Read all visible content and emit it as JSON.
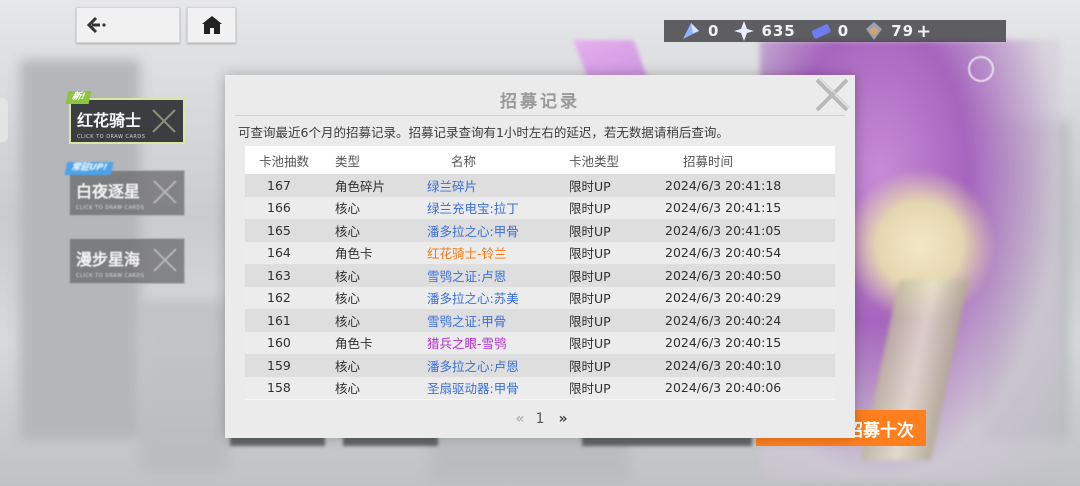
{
  "header": {
    "back_button_icon": "back-arrow-icon",
    "home_button_icon": "home-icon"
  },
  "currencies": [
    {
      "icon": "crystal-shard-icon",
      "value": "0"
    },
    {
      "icon": "star-crystal-icon",
      "value": "635"
    },
    {
      "icon": "ticket-icon",
      "value": "0"
    },
    {
      "icon": "premium-gem-icon",
      "value": "79"
    }
  ],
  "currency_plus": "+",
  "banners": [
    {
      "tag": "新!",
      "title": "红花骑士",
      "sub": "CLICK TO DRAW CARDS",
      "active": true
    },
    {
      "tag": "常驻UP!",
      "title": "白夜逐星",
      "sub": "CLICK TO DRAW CARDS",
      "active": false
    },
    {
      "tag": "",
      "title": "漫步星海",
      "sub": "CLICK TO DRAW CARDS",
      "active": false
    }
  ],
  "bottom_button_label": "招募十次",
  "modal": {
    "title": "招募记录",
    "notice": "可查询最近6个月的招募记录。招募记录查询有1小时左右的延迟，若无数据请稍后查询。",
    "columns": [
      "卡池抽数",
      "类型",
      "名称",
      "卡池类型",
      "招募时间"
    ],
    "rows": [
      {
        "num": "167",
        "type": "角色碎片",
        "name": "绿兰碎片",
        "pool": "限时UP",
        "time": "2024/6/3 20:41:18",
        "color": "#3a6fd8"
      },
      {
        "num": "166",
        "type": "核心",
        "name": "绿兰充电宝:拉丁",
        "pool": "限时UP",
        "time": "2024/6/3 20:41:15",
        "color": "#3a6fd8"
      },
      {
        "num": "165",
        "type": "核心",
        "name": "潘多拉之心:甲骨",
        "pool": "限时UP",
        "time": "2024/6/3 20:41:05",
        "color": "#3a6fd8"
      },
      {
        "num": "164",
        "type": "角色卡",
        "name": "红花骑士-铃兰",
        "pool": "限时UP",
        "time": "2024/6/3 20:40:54",
        "color": "#f07a12"
      },
      {
        "num": "163",
        "type": "核心",
        "name": "雪鸮之证:卢恩",
        "pool": "限时UP",
        "time": "2024/6/3 20:40:50",
        "color": "#3a6fd8"
      },
      {
        "num": "162",
        "type": "核心",
        "name": "潘多拉之心:苏美",
        "pool": "限时UP",
        "time": "2024/6/3 20:40:29",
        "color": "#3a6fd8"
      },
      {
        "num": "161",
        "type": "核心",
        "name": "雪鸮之证:甲骨",
        "pool": "限时UP",
        "time": "2024/6/3 20:40:24",
        "color": "#3a6fd8"
      },
      {
        "num": "160",
        "type": "角色卡",
        "name": "猎兵之眼-雪鸮",
        "pool": "限时UP",
        "time": "2024/6/3 20:40:15",
        "color": "#b22fc9"
      },
      {
        "num": "159",
        "type": "核心",
        "name": "潘多拉之心:卢恩",
        "pool": "限时UP",
        "time": "2024/6/3 20:40:10",
        "color": "#3a6fd8"
      },
      {
        "num": "158",
        "type": "核心",
        "name": "圣扇驱动器:甲骨",
        "pool": "限时UP",
        "time": "2024/6/3 20:40:06",
        "color": "#3a6fd8"
      }
    ],
    "pagination": {
      "prev": "«",
      "page": "1",
      "next": "»"
    }
  }
}
